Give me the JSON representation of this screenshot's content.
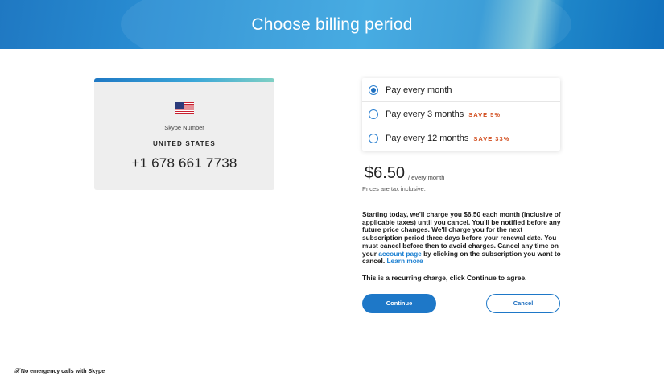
{
  "header": {
    "title": "Choose billing period"
  },
  "product": {
    "label": "Skype Number",
    "country": "UNITED STATES",
    "phone": "+1 678 661 7738",
    "flag_icon": "us-flag-icon"
  },
  "billing": {
    "options": [
      {
        "label": "Pay every month",
        "save": "",
        "selected": true
      },
      {
        "label": "Pay every 3 months",
        "save": "SAVE 5%",
        "selected": false
      },
      {
        "label": "Pay every 12 months",
        "save": "SAVE 33%",
        "selected": false
      }
    ],
    "price": "$6.50",
    "period": "/ every month",
    "tax_note": "Prices are tax inclusive."
  },
  "terms": {
    "text_1": "Starting today, we'll charge you $6.50 each month (inclusive of applicable taxes) until you cancel. You'll be notified before any future price changes. We'll charge you for the next subscription period three days before your renewal date. You must cancel before then to avoid charges. Cancel any time on your ",
    "link_1": "account page",
    "text_2": " by clicking on the subscription you want to cancel. ",
    "link_2": "Learn more",
    "recurring": "This is a recurring charge, click Continue to agree."
  },
  "actions": {
    "continue_label": "Continue",
    "cancel_label": "Cancel"
  },
  "footer": {
    "icon": "x-icon",
    "text": "No emergency calls with Skype"
  },
  "colors": {
    "accent": "#1e78c8",
    "save": "#d14a1a",
    "link": "#1a7fd1"
  }
}
